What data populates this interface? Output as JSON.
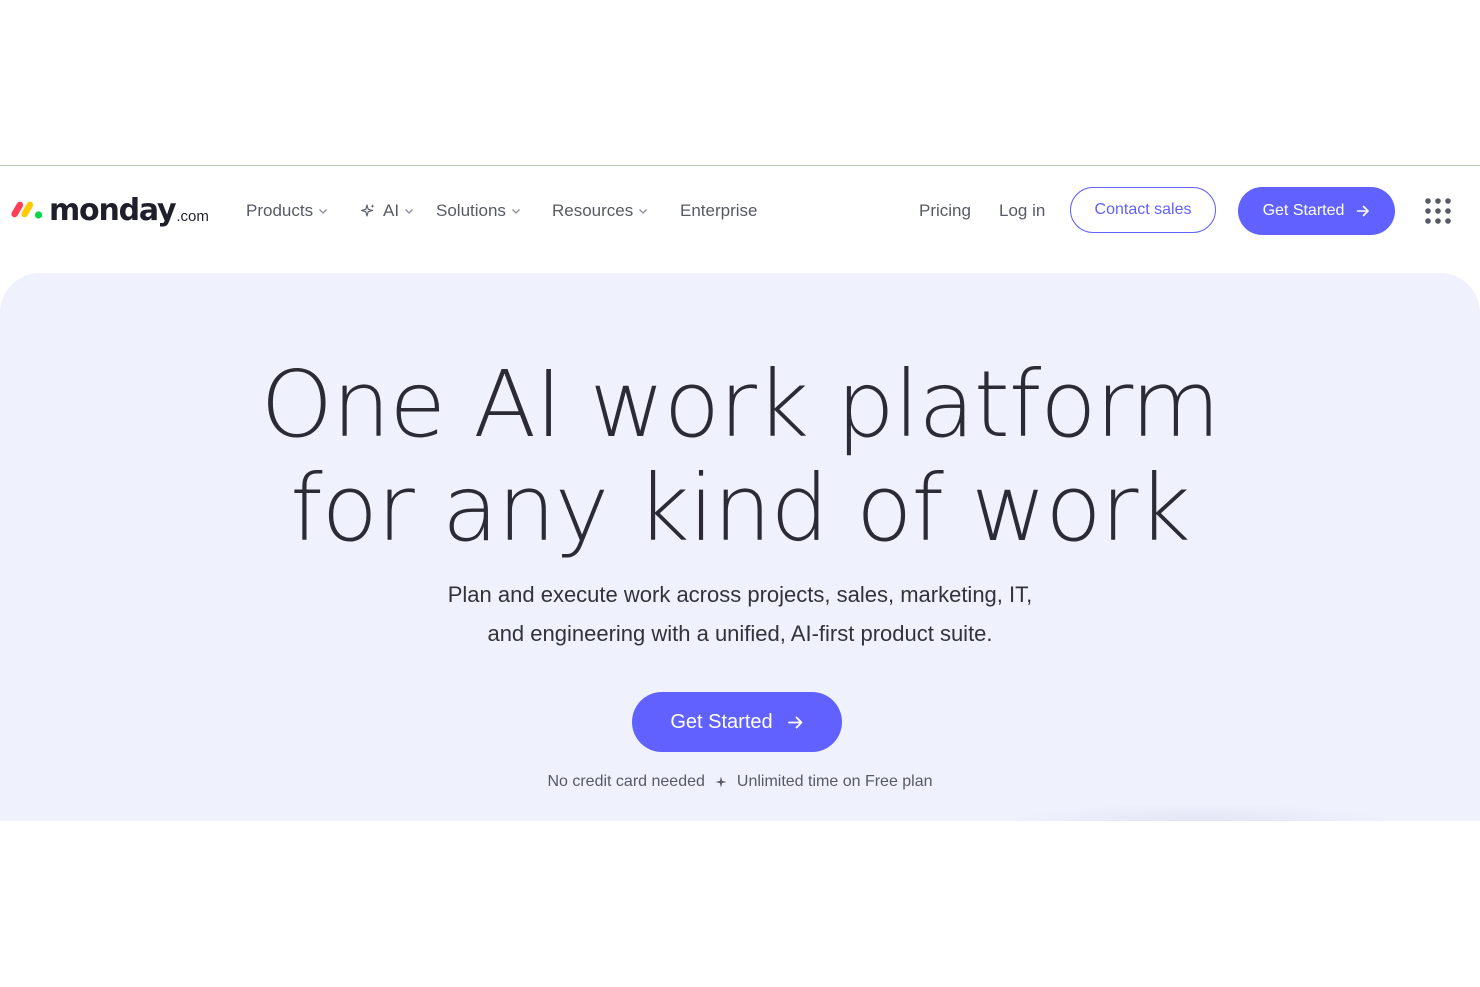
{
  "brand": {
    "wordmark": "monday",
    "tld": ".com",
    "colors": {
      "red": "#ff3d57",
      "yellow": "#ffcb00",
      "green": "#00d647",
      "text": "#1f1f2b"
    }
  },
  "nav": {
    "items": [
      {
        "label": "Products",
        "icon": "chevron-down-icon"
      },
      {
        "label": "AI",
        "icon": "sparkle-icon",
        "trailing": "chevron-down-icon"
      },
      {
        "label": "Solutions",
        "icon": "chevron-down-icon"
      },
      {
        "label": "Resources",
        "icon": "chevron-down-icon"
      },
      {
        "label": "Enterprise"
      }
    ],
    "pricing": "Pricing",
    "login": "Log in",
    "contact_sales": "Contact sales",
    "get_started": "Get Started",
    "apps_icon": "grid-dots-icon"
  },
  "hero": {
    "title_line1": "One AI work platform",
    "title_line2": "for any kind of work",
    "subtitle_line1": "Plan and execute work across projects, sales, marketing, IT,",
    "subtitle_line2": "and engineering with a unified, AI-first product suite.",
    "cta": "Get Started",
    "note_left": "No credit card needed",
    "note_separator_icon": "sparkle-icon",
    "note_right": "Unlimited time on Free plan"
  },
  "colors": {
    "accent": "#6161ff",
    "hero_bg": "#eff1fd",
    "text_primary": "#323338",
    "text_secondary": "#575a66"
  }
}
